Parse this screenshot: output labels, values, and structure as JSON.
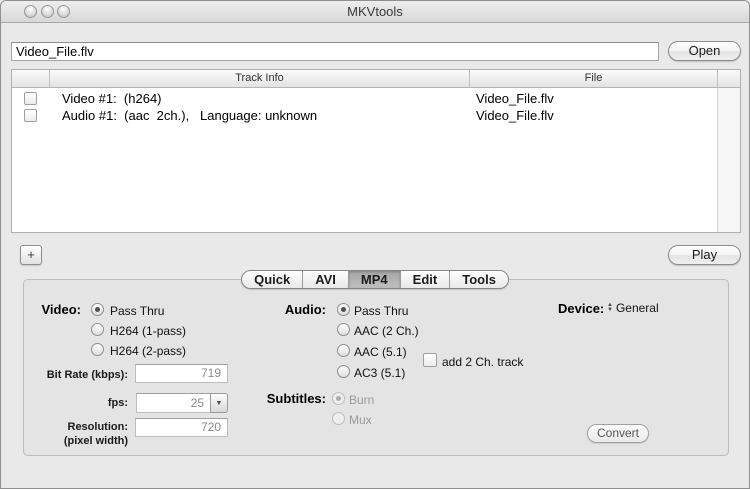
{
  "window": {
    "title": "MKVtools"
  },
  "window_buttons": {
    "close": "",
    "minimize": "",
    "zoom": ""
  },
  "file_bar": {
    "path_value": "Video_File.flv",
    "open_label": "Open"
  },
  "track_table": {
    "columns": {
      "info": "Track Info",
      "file": "File"
    },
    "rows": [
      {
        "checked": false,
        "info": "Video #1:  (h264)",
        "file": "Video_File.flv"
      },
      {
        "checked": false,
        "info": "Audio #1:  (aac  2ch.),   Language: unknown",
        "file": "Video_File.flv"
      }
    ]
  },
  "actions": {
    "add_label": "+",
    "play_label": "Play"
  },
  "tabs": [
    {
      "label": "Quick",
      "selected": false
    },
    {
      "label": "AVI",
      "selected": false
    },
    {
      "label": "MP4",
      "selected": true
    },
    {
      "label": "Edit",
      "selected": false
    },
    {
      "label": "Tools",
      "selected": false
    }
  ],
  "mp4_panel": {
    "video": {
      "label": "Video:",
      "options": [
        "Pass Thru",
        "H264 (1-pass)",
        "H264 (2-pass)"
      ],
      "selected": "Pass Thru"
    },
    "bit_rate": {
      "label": "Bit Rate (kbps):",
      "value": "719"
    },
    "fps": {
      "label": "fps:",
      "value": "25"
    },
    "resolution": {
      "label": "Resolution:",
      "sublabel": "(pixel width)",
      "value": "720"
    },
    "audio": {
      "label": "Audio:",
      "options": [
        "Pass Thru",
        "AAC (2 Ch.)",
        "AAC (5.1)",
        "AC3 (5.1)"
      ],
      "selected": "Pass Thru"
    },
    "add_track": {
      "label": "add 2 Ch. track",
      "checked": false
    },
    "subtitles": {
      "label": "Subtitles:",
      "options": [
        "Burn",
        "Mux"
      ],
      "selected": "Burn",
      "disabled": true
    },
    "device": {
      "label": "Device:",
      "value": "General"
    },
    "convert_label": "Convert"
  },
  "colors": {
    "window_bg": "#e9e9e9",
    "panel_bg": "#e4e4e4",
    "selected_tab": "#b3b3b3",
    "field_text": "#8a8a8a"
  }
}
